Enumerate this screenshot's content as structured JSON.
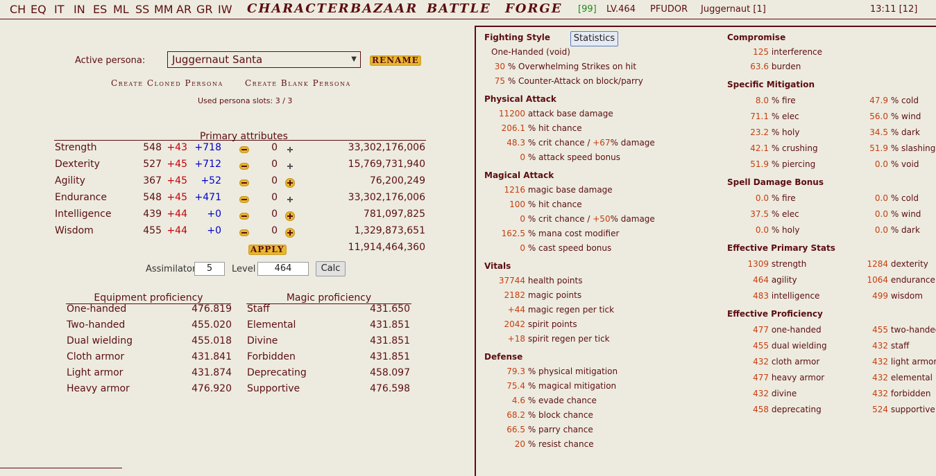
{
  "topbar": {
    "nav_short": [
      "CH",
      "EQ",
      "IT",
      "IN",
      "ES",
      "ML",
      "SS",
      "MM",
      "AR",
      "GR",
      "IW"
    ],
    "nav_fancy": [
      "CHARACTER",
      "BAZAAR",
      "BATTLE",
      "FORGE"
    ],
    "stamina": "[99]",
    "level": "LV.464",
    "difficulty": "PFUDOR",
    "persona": "Juggernaut [1]",
    "clock": "13:11 [12]"
  },
  "persona": {
    "active_label": "Active persona:",
    "selected": "Juggernaut Santa",
    "rename": "RENAME",
    "create_cloned": "Create Cloned Persona",
    "create_blank": "Create Blank Persona",
    "slots": "Used persona slots: 3 / 3"
  },
  "primary": {
    "title": "Primary attributes",
    "rows": [
      {
        "name": "Strength",
        "base": "548",
        "bonus": "+43",
        "gear": "+718",
        "value": "0",
        "exp": "33,302,176,006"
      },
      {
        "name": "Dexterity",
        "base": "527",
        "bonus": "+45",
        "gear": "+712",
        "value": "0",
        "exp": "15,769,731,940"
      },
      {
        "name": "Agility",
        "base": "367",
        "bonus": "+45",
        "gear": "+52",
        "value": "0",
        "exp": "76,200,249"
      },
      {
        "name": "Endurance",
        "base": "548",
        "bonus": "+45",
        "gear": "+471",
        "value": "0",
        "exp": "33,302,176,006"
      },
      {
        "name": "Intelligence",
        "base": "439",
        "bonus": "+44",
        "gear": "+0",
        "value": "0",
        "exp": "781,097,825"
      },
      {
        "name": "Wisdom",
        "base": "455",
        "bonus": "+44",
        "gear": "+0",
        "value": "0",
        "exp": "1,329,873,651"
      }
    ],
    "apply": "APPLY",
    "remaining_exp": "11,914,464,360"
  },
  "calc": {
    "assimilator_label": "Assimilator",
    "assimilator_value": "5",
    "level_label": "Level",
    "level_value": "464",
    "calc_button": "Calc"
  },
  "equipment_prof": {
    "title": "Equipment proficiency",
    "rows": [
      {
        "name": "One-handed",
        "value": "476.819"
      },
      {
        "name": "Two-handed",
        "value": "455.020"
      },
      {
        "name": "Dual wielding",
        "value": "455.018"
      },
      {
        "name": "Cloth armor",
        "value": "431.841"
      },
      {
        "name": "Light armor",
        "value": "431.874"
      },
      {
        "name": "Heavy armor",
        "value": "476.920"
      }
    ]
  },
  "magic_prof": {
    "title": "Magic proficiency",
    "rows": [
      {
        "name": "Staff",
        "value": "431.650"
      },
      {
        "name": "Elemental",
        "value": "431.851"
      },
      {
        "name": "Divine",
        "value": "431.851"
      },
      {
        "name": "Forbidden",
        "value": "431.851"
      },
      {
        "name": "Deprecating",
        "value": "458.097"
      },
      {
        "name": "Supportive",
        "value": "476.598"
      }
    ]
  },
  "stats": {
    "statistics_button": "Statistics",
    "fighting_style": {
      "title": "Fighting Style",
      "style": "One-Handed (void)",
      "items": [
        {
          "num": "30",
          "txt": "% Overwhelming Strikes on hit"
        },
        {
          "num": "75",
          "txt": "% Counter-Attack on block/parry"
        }
      ]
    },
    "physical_attack": {
      "title": "Physical Attack",
      "items": [
        {
          "num": "11200",
          "txt": "attack base damage"
        },
        {
          "num": "206.1",
          "txt": "% hit chance"
        },
        {
          "num": "48.3",
          "txt": "% crit chance / ",
          "num2": "+67",
          "txt2": "% damage"
        },
        {
          "num": "0",
          "txt": "% attack speed bonus"
        }
      ]
    },
    "magical_attack": {
      "title": "Magical Attack",
      "items": [
        {
          "num": "1216",
          "txt": "magic base damage"
        },
        {
          "num": "100",
          "txt": "% hit chance"
        },
        {
          "num": "0",
          "txt": "% crit chance / ",
          "num2": "+50",
          "txt2": "% damage"
        },
        {
          "num": "162.5",
          "txt": "% mana cost modifier"
        },
        {
          "num": "0",
          "txt": "% cast speed bonus"
        }
      ]
    },
    "vitals": {
      "title": "Vitals",
      "items": [
        {
          "num": "37744",
          "txt": "health points"
        },
        {
          "num": "2182",
          "txt": "magic points"
        },
        {
          "num": "+44",
          "txt": "magic regen per tick"
        },
        {
          "num": "2042",
          "txt": "spirit points"
        },
        {
          "num": "+18",
          "txt": "spirit regen per tick"
        }
      ]
    },
    "defense": {
      "title": "Defense",
      "items": [
        {
          "num": "79.3",
          "txt": "% physical mitigation"
        },
        {
          "num": "75.4",
          "txt": "% magical mitigation"
        },
        {
          "num": "4.6",
          "txt": "% evade chance"
        },
        {
          "num": "68.2",
          "txt": "% block chance"
        },
        {
          "num": "66.5",
          "txt": "% parry chance"
        },
        {
          "num": "20",
          "txt": "% resist chance"
        }
      ]
    },
    "compromise": {
      "title": "Compromise",
      "items": [
        {
          "num": "125",
          "txt": "interference"
        },
        {
          "num": "63.6",
          "txt": "burden"
        }
      ]
    },
    "specific_mitigation": {
      "title": "Specific Mitigation",
      "left": [
        {
          "num": "8.0",
          "txt": "% fire"
        },
        {
          "num": "71.1",
          "txt": "% elec"
        },
        {
          "num": "23.2",
          "txt": "% holy"
        },
        {
          "num": "42.1",
          "txt": "% crushing"
        },
        {
          "num": "51.9",
          "txt": "% piercing"
        }
      ],
      "right": [
        {
          "num": "47.9",
          "txt": "% cold"
        },
        {
          "num": "56.0",
          "txt": "% wind"
        },
        {
          "num": "34.5",
          "txt": "% dark"
        },
        {
          "num": "51.9",
          "txt": "% slashing"
        },
        {
          "num": "0.0",
          "txt": "% void"
        }
      ]
    },
    "spell_damage": {
      "title": "Spell Damage Bonus",
      "left": [
        {
          "num": "0.0",
          "txt": "% fire"
        },
        {
          "num": "37.5",
          "txt": "% elec"
        },
        {
          "num": "0.0",
          "txt": "% holy"
        }
      ],
      "right": [
        {
          "num": "0.0",
          "txt": "% cold"
        },
        {
          "num": "0.0",
          "txt": "% wind"
        },
        {
          "num": "0.0",
          "txt": "% dark"
        }
      ]
    },
    "effective_primary": {
      "title": "Effective Primary Stats",
      "left": [
        {
          "num": "1309",
          "txt": "strength"
        },
        {
          "num": "464",
          "txt": "agility"
        },
        {
          "num": "483",
          "txt": "intelligence"
        }
      ],
      "right": [
        {
          "num": "1284",
          "txt": "dexterity"
        },
        {
          "num": "1064",
          "txt": "endurance"
        },
        {
          "num": "499",
          "txt": "wisdom"
        }
      ]
    },
    "effective_prof": {
      "title": "Effective Proficiency",
      "left": [
        {
          "num": "477",
          "txt": "one-handed"
        },
        {
          "num": "455",
          "txt": "dual wielding"
        },
        {
          "num": "432",
          "txt": "cloth armor"
        },
        {
          "num": "477",
          "txt": "heavy armor"
        },
        {
          "num": "432",
          "txt": "divine"
        },
        {
          "num": "458",
          "txt": "deprecating"
        }
      ],
      "right": [
        {
          "num": "455",
          "txt": "two-handed"
        },
        {
          "num": "432",
          "txt": "staff"
        },
        {
          "num": "432",
          "txt": "light armor"
        },
        {
          "num": "432",
          "txt": "elemental"
        },
        {
          "num": "432",
          "txt": "forbidden"
        },
        {
          "num": "524",
          "txt": "supportive"
        }
      ]
    }
  }
}
